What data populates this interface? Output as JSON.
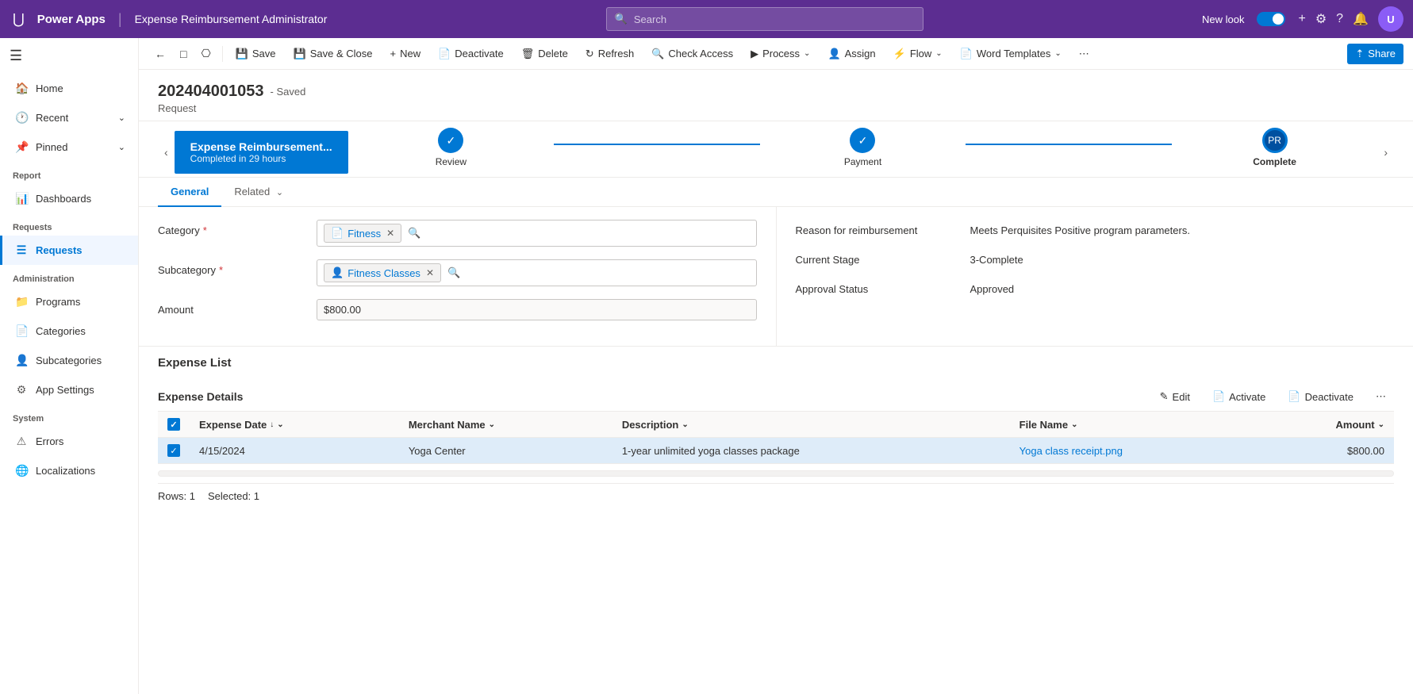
{
  "topNav": {
    "gridIconLabel": "⊞",
    "appName": "Power Apps",
    "separator": "|",
    "pageTitle": "Expense Reimbursement Administrator",
    "searchPlaceholder": "Search",
    "newLookLabel": "New look",
    "addIconLabel": "+",
    "settingsIconLabel": "⚙",
    "helpIconLabel": "?",
    "notifIconLabel": "🔔",
    "avatarLabel": "U"
  },
  "toolbar": {
    "backLabel": "←",
    "pageLabel": "□",
    "copyLabel": "⎘",
    "saveLabel": "Save",
    "saveCloseLabel": "Save & Close",
    "newLabel": "New",
    "deactivateLabel": "Deactivate",
    "deleteLabel": "Delete",
    "refreshLabel": "Refresh",
    "checkAccessLabel": "Check Access",
    "processLabel": "Process",
    "assignLabel": "Assign",
    "flowLabel": "Flow",
    "wordTemplatesLabel": "Word Templates",
    "moreLabel": "⋯",
    "shareLabel": "Share"
  },
  "record": {
    "id": "202404001053",
    "savedLabel": "Saved",
    "type": "Request"
  },
  "stages": [
    {
      "label": "Review",
      "completed": true,
      "active": false
    },
    {
      "label": "Payment",
      "completed": true,
      "active": false
    },
    {
      "label": "Complete",
      "completed": true,
      "active": true
    }
  ],
  "activeStage": {
    "name": "Expense Reimbursement...",
    "time": "Completed in 29 hours"
  },
  "tabs": [
    {
      "label": "General",
      "active": true
    },
    {
      "label": "Related",
      "active": false
    }
  ],
  "form": {
    "categoryLabel": "Category",
    "categoryValue": "Fitness",
    "categoryIcon": "📄",
    "subcategoryLabel": "Subcategory",
    "subcategoryValue": "Fitness Classes",
    "subcategoryIcon": "👤",
    "amountLabel": "Amount",
    "amountValue": "$800.00",
    "reasonLabel": "Reason for reimbursement",
    "reasonValue": "Meets Perquisites Positive program parameters.",
    "currentStageLabel": "Current Stage",
    "currentStageValue": "3-Complete",
    "approvalStatusLabel": "Approval Status",
    "approvalStatusValue": "Approved"
  },
  "expenseList": {
    "sectionTitle": "Expense List",
    "subtableTitle": "Expense Details",
    "editLabel": "Edit",
    "activateLabel": "Activate",
    "deactivateLabel": "Deactivate",
    "moreLabel": "⋯",
    "columns": {
      "checkbox": "",
      "expenseDate": "Expense Date",
      "merchantName": "Merchant Name",
      "description": "Description",
      "fileName": "File Name",
      "amount": "Amount"
    },
    "rows": [
      {
        "selected": true,
        "expenseDate": "4/15/2024",
        "merchantName": "Yoga Center",
        "description": "1-year unlimited yoga classes package",
        "fileName": "Yoga class receipt.png",
        "amount": "$800.00"
      }
    ],
    "footer": {
      "rowsLabel": "Rows: 1",
      "selectedLabel": "Selected: 1"
    }
  },
  "sidebar": {
    "menuIcon": "☰",
    "sections": [
      {
        "items": [
          {
            "label": "Home",
            "icon": "🏠",
            "active": false,
            "id": "home"
          }
        ]
      },
      {
        "items": [
          {
            "label": "Recent",
            "icon": "🕐",
            "active": false,
            "id": "recent",
            "hasChevron": true
          }
        ]
      },
      {
        "items": [
          {
            "label": "Pinned",
            "icon": "📌",
            "active": false,
            "id": "pinned",
            "hasChevron": true
          }
        ]
      },
      {
        "title": "Report",
        "items": [
          {
            "label": "Dashboards",
            "icon": "📊",
            "active": false,
            "id": "dashboards"
          }
        ]
      },
      {
        "title": "Requests",
        "items": [
          {
            "label": "Requests",
            "icon": "≡",
            "active": true,
            "id": "requests"
          }
        ]
      },
      {
        "title": "Administration",
        "items": [
          {
            "label": "Programs",
            "icon": "📁",
            "active": false,
            "id": "programs"
          },
          {
            "label": "Categories",
            "icon": "📄",
            "active": false,
            "id": "categories"
          },
          {
            "label": "Subcategories",
            "icon": "👤",
            "active": false,
            "id": "subcategories"
          },
          {
            "label": "App Settings",
            "icon": "⚙",
            "active": false,
            "id": "app-settings"
          }
        ]
      },
      {
        "title": "System",
        "items": [
          {
            "label": "Errors",
            "icon": "⚠",
            "active": false,
            "id": "errors"
          },
          {
            "label": "Localizations",
            "icon": "🌐",
            "active": false,
            "id": "localizations"
          }
        ]
      }
    ]
  }
}
